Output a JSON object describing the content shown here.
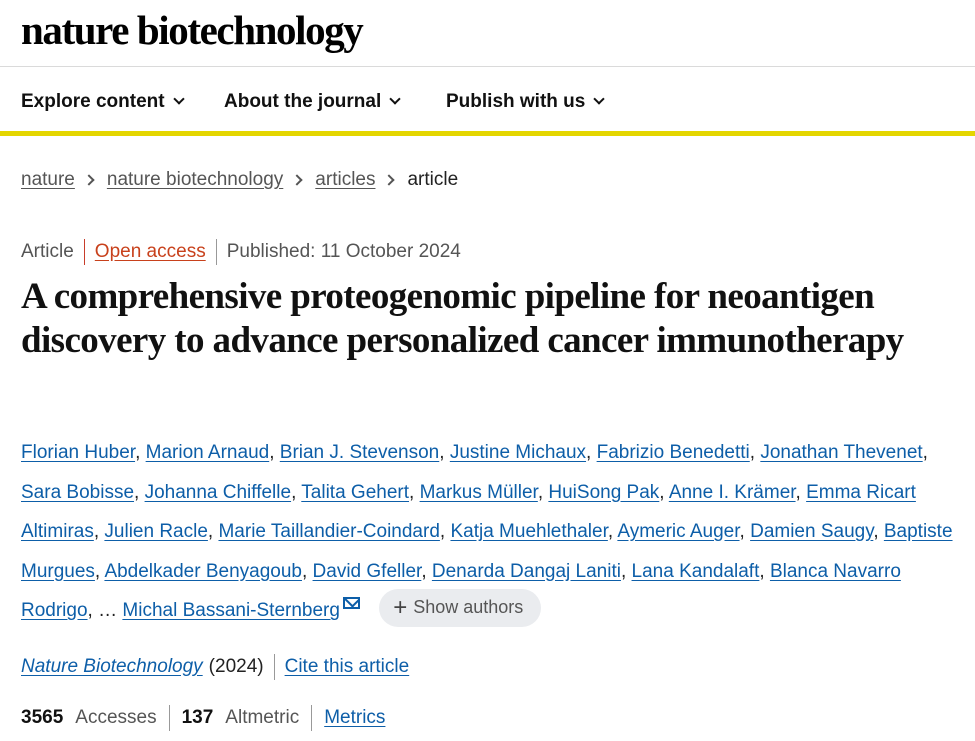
{
  "site": {
    "logo": "nature biotechnology"
  },
  "nav": {
    "items": [
      {
        "label": "Explore content"
      },
      {
        "label": "About the journal"
      },
      {
        "label": "Publish with us"
      }
    ]
  },
  "breadcrumb": {
    "items": [
      "nature",
      "nature biotechnology",
      "articles"
    ],
    "current": "article"
  },
  "meta": {
    "type": "Article",
    "access": "Open access",
    "published": "Published: 11 October 2024"
  },
  "title": "A comprehensive proteogenomic pipeline for neoantigen discovery to advance personalized cancer immunotherapy",
  "authors": [
    "Florian Huber",
    "Marion Arnaud",
    "Brian J. Stevenson",
    "Justine Michaux",
    "Fabrizio Benedetti",
    "Jonathan Thevenet",
    "Sara Bobisse",
    "Johanna Chiffelle",
    "Talita Gehert",
    "Markus Müller",
    "HuiSong Pak",
    "Anne I. Krämer",
    "Emma Ricart Altimiras",
    "Julien Racle",
    "Marie Taillandier-Coindard",
    "Katja Muehlethaler",
    "Aymeric Auger",
    "Damien Saugy",
    "Baptiste Murgues",
    "Abdelkader Benyagoub",
    "David Gfeller",
    "Denarda Dangaj Laniti",
    "Lana Kandalaft",
    "Blanca Navarro Rodrigo"
  ],
  "authors_ellipsis": "…",
  "corresponding_author": "Michal Bassani-Sternberg",
  "show_authors_label": "Show authors",
  "citation": {
    "journal": "Nature Biotechnology",
    "year": "(2024)",
    "cite_label": "Cite this article"
  },
  "metrics": {
    "accesses_value": "3565",
    "accesses_label": "Accesses",
    "altmetric_value": "137",
    "altmetric_label": "Altmetric",
    "metrics_link": "Metrics"
  },
  "colors": {
    "nav_underline": "#e4d600",
    "open_access": "#c8411c",
    "link": "#0d5ea8"
  }
}
